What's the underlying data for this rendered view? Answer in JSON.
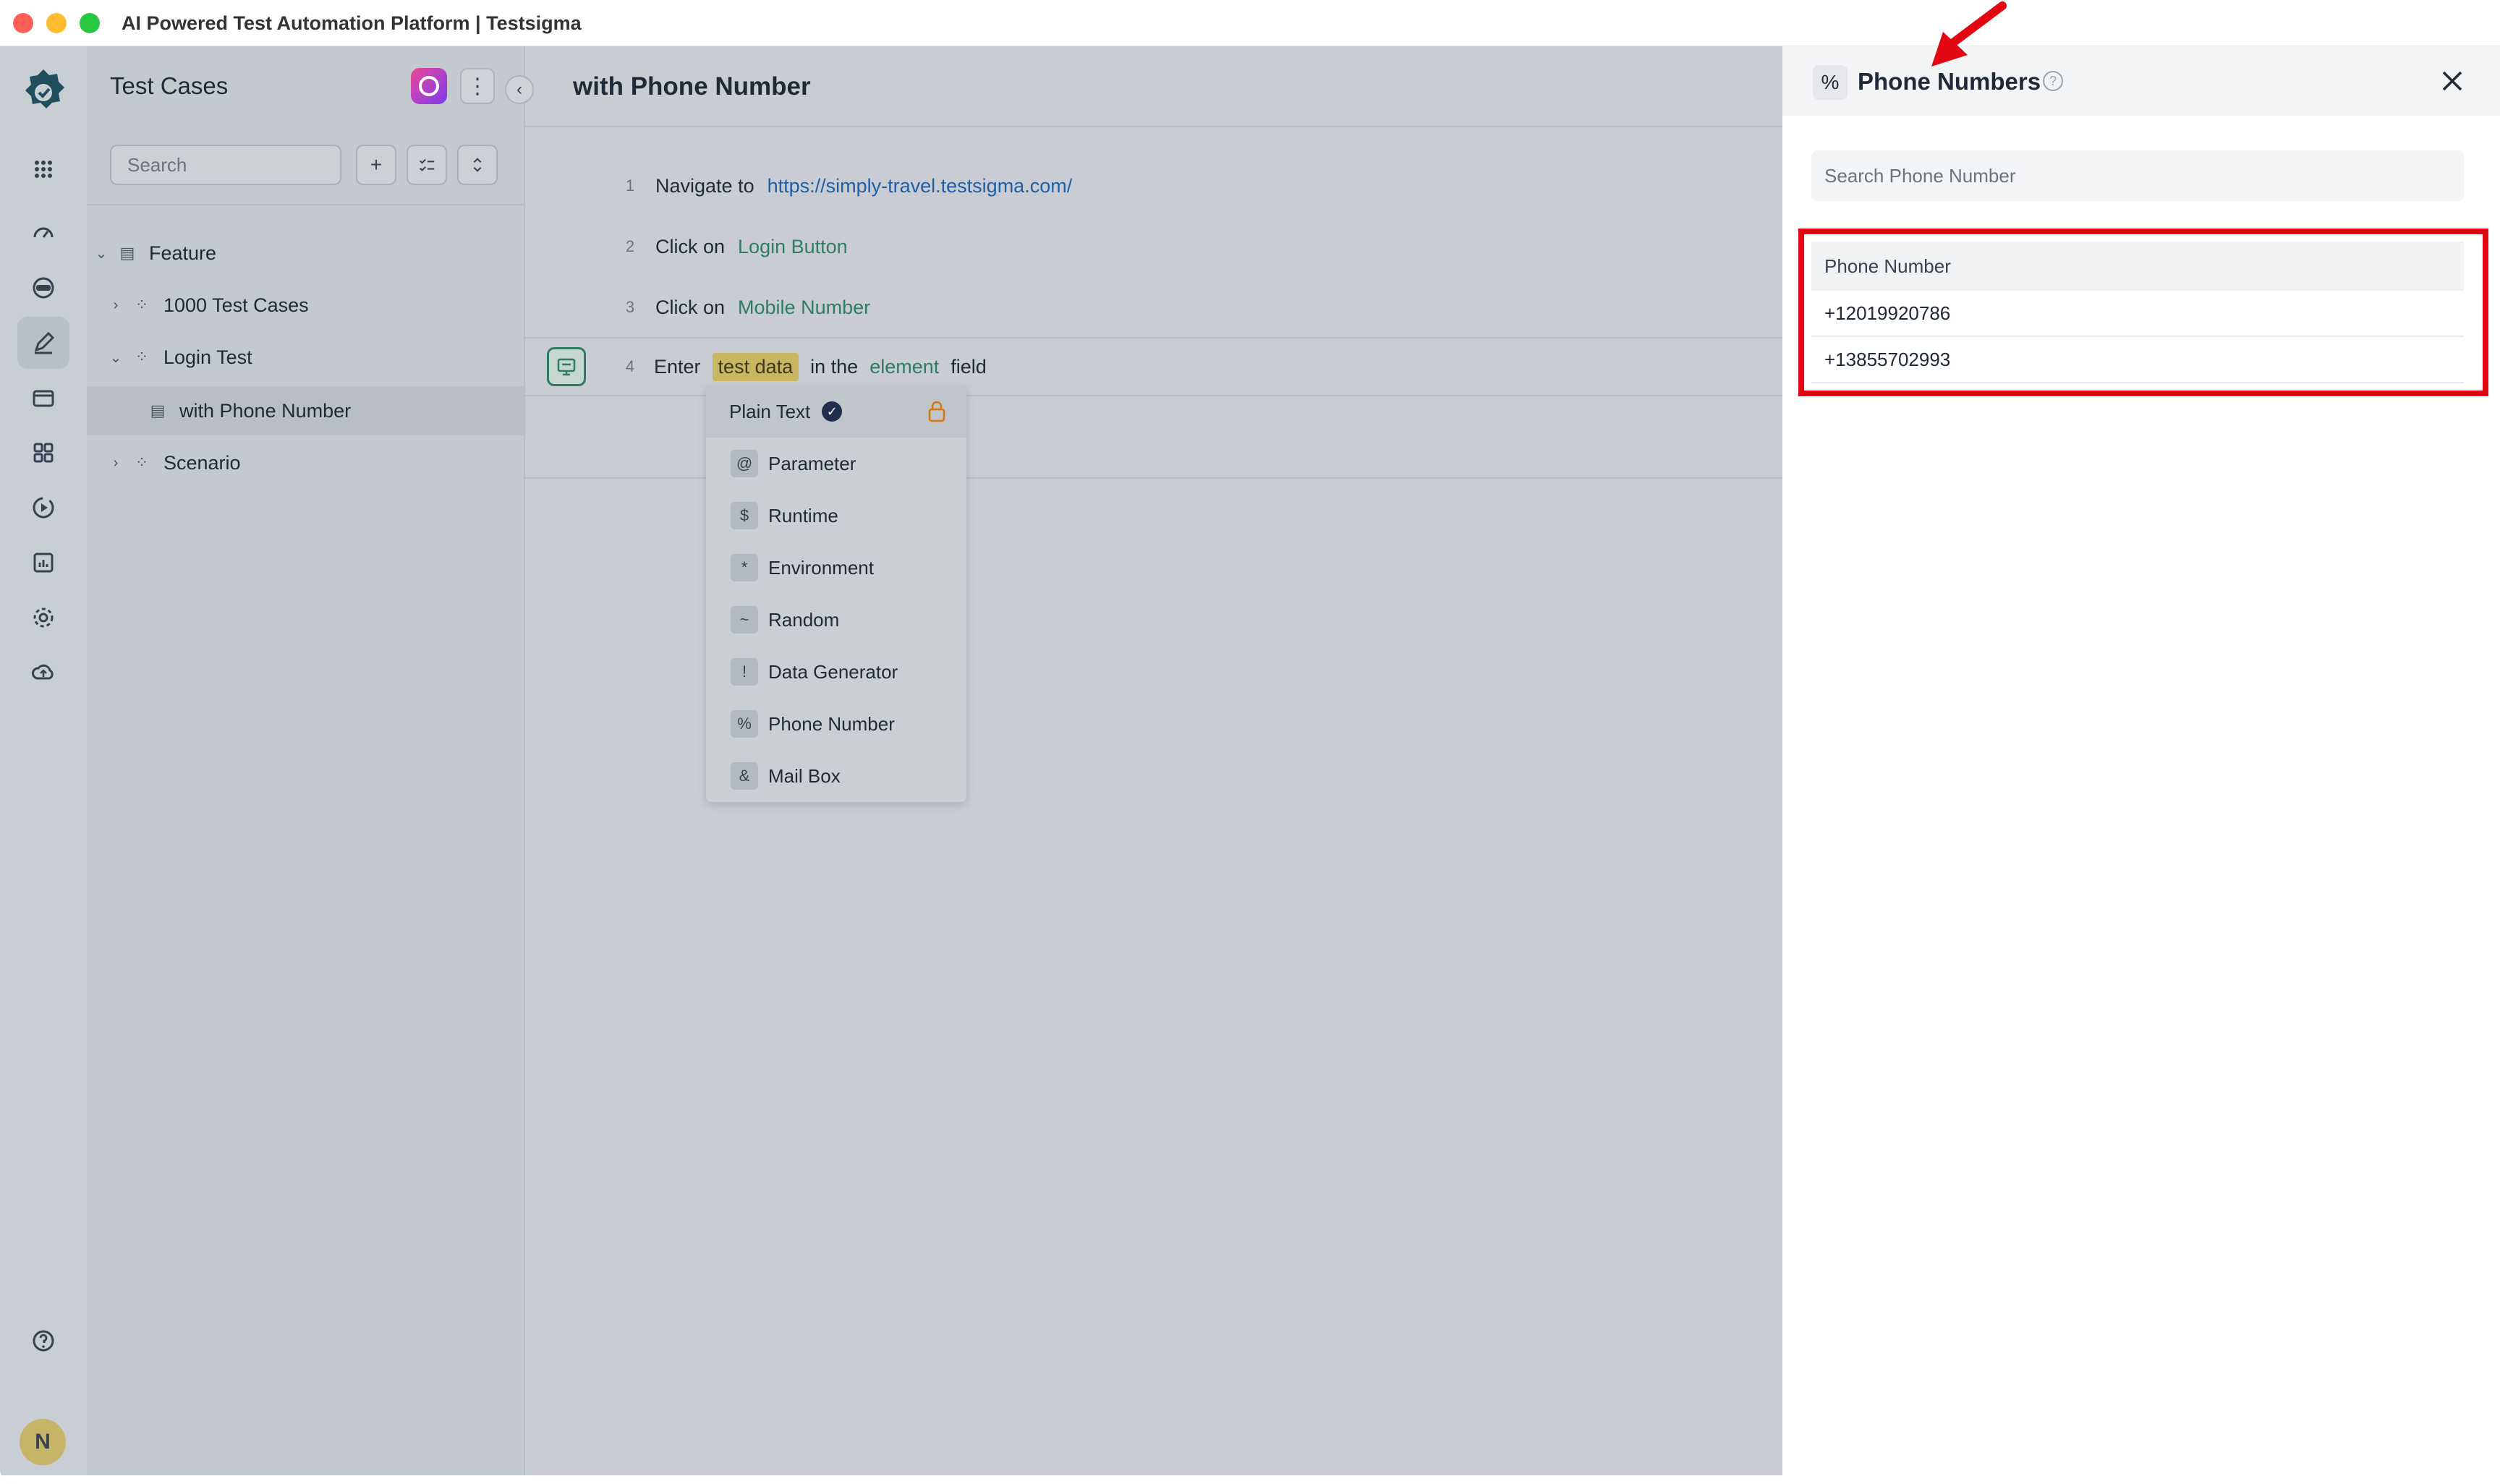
{
  "window": {
    "title": "AI Powered Test Automation Platform | Testsigma"
  },
  "rail": {
    "avatar_initial": "N",
    "items": [
      "apps-icon",
      "dashboard-icon",
      "recorder-icon",
      "test-cases-icon",
      "suites-icon",
      "elements-icon",
      "runs-icon",
      "reports-icon",
      "settings-icon",
      "cloud-icon"
    ]
  },
  "panel": {
    "title": "Test Cases",
    "search_placeholder": "Search",
    "tree": [
      {
        "label": "Feature",
        "level": 0,
        "expanded": true
      },
      {
        "label": "1000 Test Cases",
        "level": 1,
        "expanded": false
      },
      {
        "label": "Login Test",
        "level": 1,
        "expanded": true
      },
      {
        "label": "with Phone Number",
        "level": 2,
        "selected": true
      },
      {
        "label": "Scenario",
        "level": 1,
        "expanded": false
      }
    ]
  },
  "main": {
    "title": "with Phone Number",
    "steps": [
      {
        "num": "1",
        "action": "Navigate to",
        "target": "https://simply-travel.testsigma.com/"
      },
      {
        "num": "2",
        "action": "Click on",
        "target": "Login Button"
      },
      {
        "num": "3",
        "action": "Click on",
        "target": "Mobile Number"
      },
      {
        "num": "4",
        "action": "Enter",
        "data": "test data",
        "mid": "in the",
        "target": "element",
        "suffix": "field"
      }
    ]
  },
  "dropdown": {
    "items": [
      {
        "symbol": "",
        "label": "Plain Text"
      },
      {
        "symbol": "@",
        "label": "Parameter"
      },
      {
        "symbol": "$",
        "label": "Runtime"
      },
      {
        "symbol": "*",
        "label": "Environment"
      },
      {
        "symbol": "~",
        "label": "Random"
      },
      {
        "symbol": "!",
        "label": "Data Generator"
      },
      {
        "symbol": "%",
        "label": "Phone Number"
      },
      {
        "symbol": "&",
        "label": "Mail Box"
      }
    ]
  },
  "drawer": {
    "symbol": "%",
    "title": "Phone Numbers",
    "search_placeholder": "Search Phone Number",
    "table_header": "Phone Number",
    "rows": [
      "+12019920786",
      "+13855702993"
    ]
  },
  "colors": {
    "highlight": "#e30613",
    "accent_green": "#2f7d60",
    "link_blue": "#1e5fa8",
    "test_data_bg": "#c8b661"
  }
}
